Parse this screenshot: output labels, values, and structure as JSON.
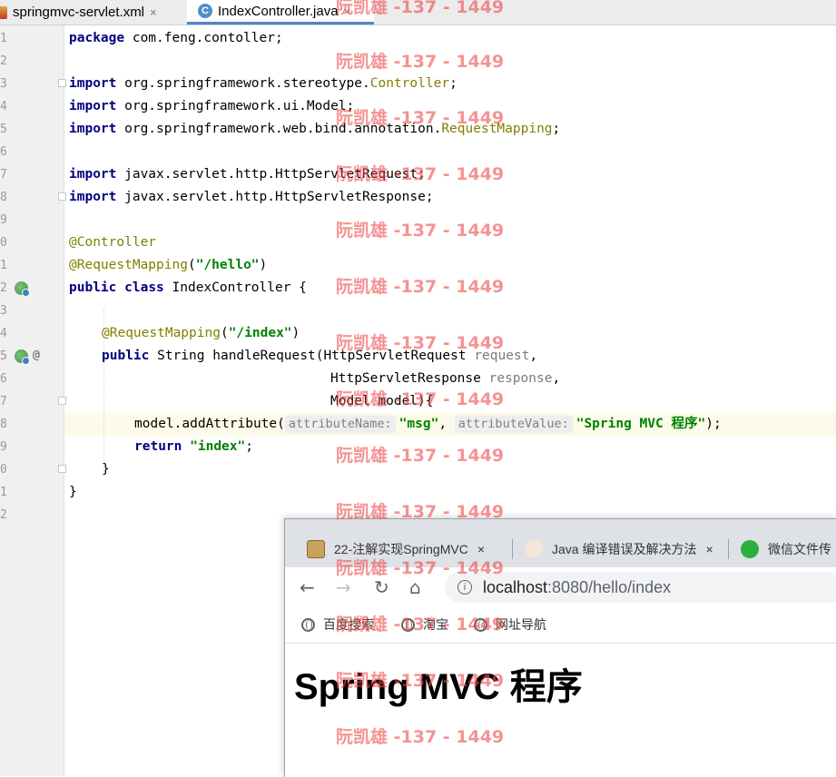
{
  "editor_tabs": [
    {
      "label": "springmvc-servlet.xml",
      "close": "×"
    },
    {
      "label": "IndexController.java",
      "close": "×"
    }
  ],
  "gutter": {
    "line_numbers": [
      "1",
      "2",
      "3",
      "4",
      "5",
      "6",
      "7",
      "8",
      "9",
      "0",
      "1",
      "2",
      "3",
      "4",
      "5",
      "6",
      "7",
      "8",
      "9",
      "0",
      "1",
      "2"
    ],
    "at_marker": "@"
  },
  "code": {
    "l1_kw": "package",
    "l1_rest": " com.feng.contoller;",
    "import_kw": "import",
    "l3_pkg": " org.springframework.stereotype.",
    "l3_cls": "Controller",
    "semi": ";",
    "l4_rest": " org.springframework.ui.Model;",
    "l5_pkg": " org.springframework.web.bind.annotation.",
    "l5_cls": "RequestMapping",
    "l7_rest": " javax.servlet.http.HttpServletRequest;",
    "l8_rest": " javax.servlet.http.HttpServletResponse;",
    "l10_ann": "@Controller",
    "l11_ann": "@RequestMapping",
    "l11_open": "(",
    "l11_str": "\"/hello\"",
    "l11_close": ")",
    "public_kw": "public",
    "class_kw": "class",
    "l12_rest": " IndexController {",
    "l14_ann": "@RequestMapping",
    "l14_str": "\"/index\"",
    "l15_rest": " String handleRequest(HttpServletRequest ",
    "l15_param": "request",
    "l15_comma": ",",
    "l16_type": "HttpServletResponse ",
    "l16_param": "response",
    "l16_comma": ",",
    "l17": "Model model){",
    "l18_call": "model.addAttribute(",
    "l18_hint1": "attributeName:",
    "l18_str1": "\"msg\"",
    "l18_sep": ", ",
    "l18_hint2": "attributeValue:",
    "l18_str2": "\"Spring MVC 程序\"",
    "l18_end": ");",
    "return_kw": "return",
    "l19_str": "\"index\"",
    "l19_end": ";",
    "brace": "}"
  },
  "browser": {
    "tabs": [
      {
        "label": "22-注解实现SpringMVC",
        "close": "×"
      },
      {
        "label": "Java 编译错误及解决方法",
        "close": "×"
      },
      {
        "label": "微信文件传"
      }
    ],
    "nav": {
      "back": "←",
      "forward": "→",
      "reload": "↻",
      "home": "⌂"
    },
    "info_glyph": "i",
    "url_host": "localhost",
    "url_rest": ":8080/hello/index",
    "bookmarks": [
      "百度搜索",
      "淘宝",
      "网址导航"
    ],
    "heading": "Spring MVC 程序"
  },
  "watermark": "阮凯雄 -137 - 1449",
  "colors": {
    "keyword": "#000080",
    "string": "#008000",
    "annotation": "#808000",
    "current_line": "#fcfae8",
    "tab_underline": "#4a88c7",
    "watermark": "#ec4b4b"
  }
}
